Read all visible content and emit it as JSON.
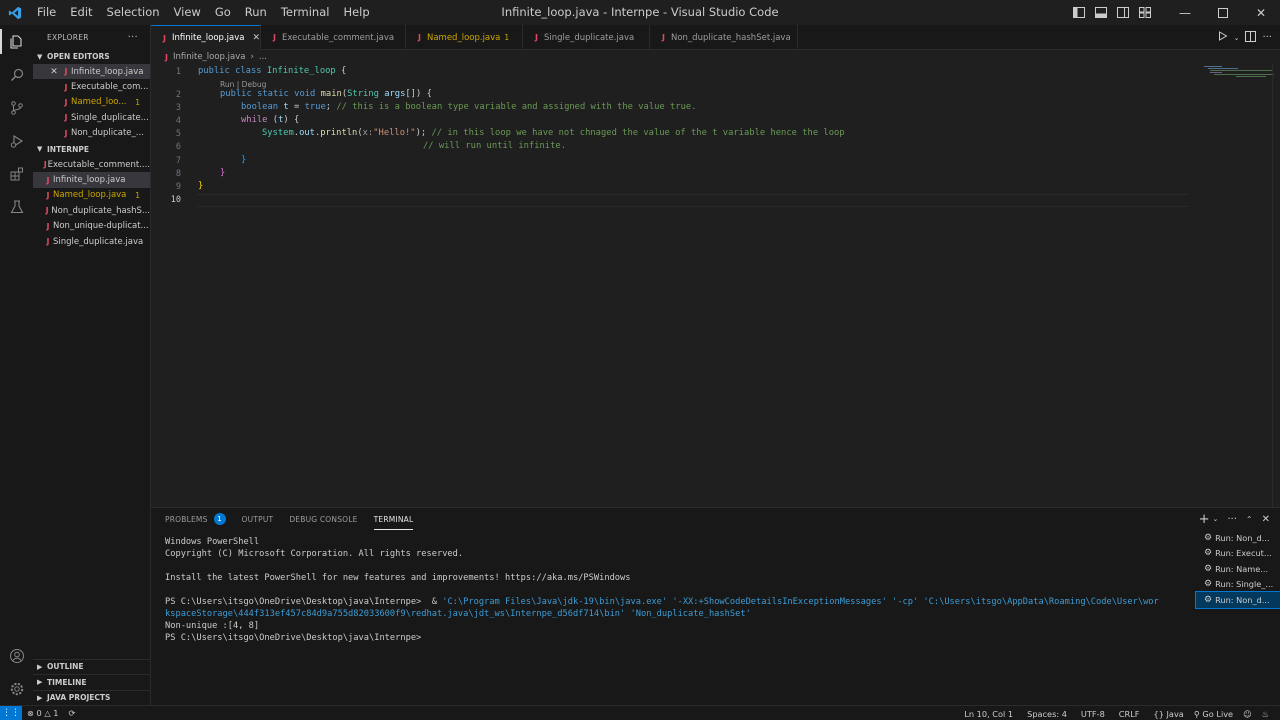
{
  "window": {
    "title": "Infinite_loop.java - Internpe - Visual Studio Code"
  },
  "menu": [
    "File",
    "Edit",
    "Selection",
    "View",
    "Go",
    "Run",
    "Terminal",
    "Help"
  ],
  "sidebar": {
    "header": "EXPLORER",
    "open_editors_label": "OPEN EDITORS",
    "open_editors": [
      {
        "name": "Infinite_loop.java",
        "selected": true
      },
      {
        "name": "Executable_com...",
        "selected": false
      },
      {
        "name": "Named_loo...",
        "badge": "1",
        "warn": true
      },
      {
        "name": "Single_duplicate...",
        "selected": false
      },
      {
        "name": "Non_duplicate_...",
        "selected": false
      }
    ],
    "project_label": "INTERNPE",
    "project_files": [
      {
        "name": "Executable_comment...."
      },
      {
        "name": "Infinite_loop.java",
        "selected": true
      },
      {
        "name": "Named_loop.java",
        "badge": "1",
        "warn": true
      },
      {
        "name": "Non_duplicate_hashS..."
      },
      {
        "name": "Non_unique-duplicat..."
      },
      {
        "name": "Single_duplicate.java"
      }
    ],
    "bottom_sections": [
      "OUTLINE",
      "TIMELINE",
      "JAVA PROJECTS"
    ]
  },
  "tabs": [
    {
      "name": "Infinite_loop.java",
      "active": true
    },
    {
      "name": "Executable_comment.java"
    },
    {
      "name": "Named_loop.java",
      "badge": "1",
      "warn": true
    },
    {
      "name": "Single_duplicate.java"
    },
    {
      "name": "Non_duplicate_hashSet.java"
    }
  ],
  "breadcrumb": {
    "file": "Infinite_loop.java",
    "rest": "..."
  },
  "editor": {
    "line_numbers": [
      "1",
      "2",
      "3",
      "4",
      "5",
      "6",
      "7",
      "8",
      "9",
      "10"
    ],
    "codelens": "Run | Debug",
    "lines": {
      "l1_a": "public",
      "l1_b": "class",
      "l1_c": "Infinite_loop",
      "l1_d": " {",
      "l2_a": "public",
      "l2_b": "static",
      "l2_c": "void",
      "l2_d": "main",
      "l2_e": "(",
      "l2_f": "String",
      "l2_g": "args",
      "l2_h": "[]) {",
      "l3_a": "boolean",
      "l3_b": "t",
      "l3_c": " = ",
      "l3_d": "true",
      "l3_e": "; ",
      "l3_f": "// this is a boolean type variable and assigned with the value true.",
      "l4_a": "while",
      "l4_b": " (",
      "l4_c": "t",
      "l4_d": ") {",
      "l5_a": "System",
      "l5_b": ".",
      "l5_c": "out",
      "l5_d": ".",
      "l5_e": "println",
      "l5_f": "(",
      "l5_g": "x:",
      "l5_h": "\"Hello!\"",
      "l5_i": "); ",
      "l5_j": "// in this loop we have not chnaged the value of the t variable hence the loop",
      "l6_a": "// will run until infinite.",
      "l7_a": "}",
      "l8_a": "}",
      "l9_a": "}"
    }
  },
  "panel": {
    "tabs": [
      {
        "label": "PROBLEMS",
        "badge": "1"
      },
      {
        "label": "OUTPUT"
      },
      {
        "label": "DEBUG CONSOLE"
      },
      {
        "label": "TERMINAL",
        "active": true
      }
    ],
    "terminal": {
      "l1": "Windows PowerShell",
      "l2": "Copyright (C) Microsoft Corporation. All rights reserved.",
      "l3": "Install the latest PowerShell for new features and improvements! https://aka.ms/PSWindows",
      "l4_prompt": "PS C:\\Users\\itsgo\\OneDrive\\Desktop\\java\\Internpe>  & ",
      "l4_cmd": "'C:\\Program Files\\Java\\jdk-19\\bin\\java.exe' '-XX:+ShowCodeDetailsInExceptionMessages' '-cp' 'C:\\Users\\itsgo\\AppData\\Roaming\\Code\\User\\wor",
      "l5_cmd": "kspaceStorage\\444f313ef457c84d9a755d82033600f9\\redhat.java\\jdt_ws\\Internpe_d56df714\\bin' 'Non_duplicate_hashSet'",
      "l6": "Non-unique :[4, 8]",
      "l7": "PS C:\\Users\\itsgo\\OneDrive\\Desktop\\java\\Internpe>"
    },
    "terminal_list": [
      {
        "label": "Run: Non_d..."
      },
      {
        "label": "Run: Execut..."
      },
      {
        "label": "Run: Name..."
      },
      {
        "label": "Run: Single_..."
      },
      {
        "label": "Run: Non_d...",
        "selected": true
      }
    ]
  },
  "statusbar": {
    "errors": "0",
    "warnings": "1",
    "position": "Ln 10, Col 1",
    "spaces": "Spaces: 4",
    "encoding": "UTF-8",
    "eol": "CRLF",
    "language": "Java",
    "golive": "Go Live"
  },
  "colors": {
    "accent": "#0078d4",
    "warning": "#cca700",
    "java_icon": "#e04a5f"
  }
}
